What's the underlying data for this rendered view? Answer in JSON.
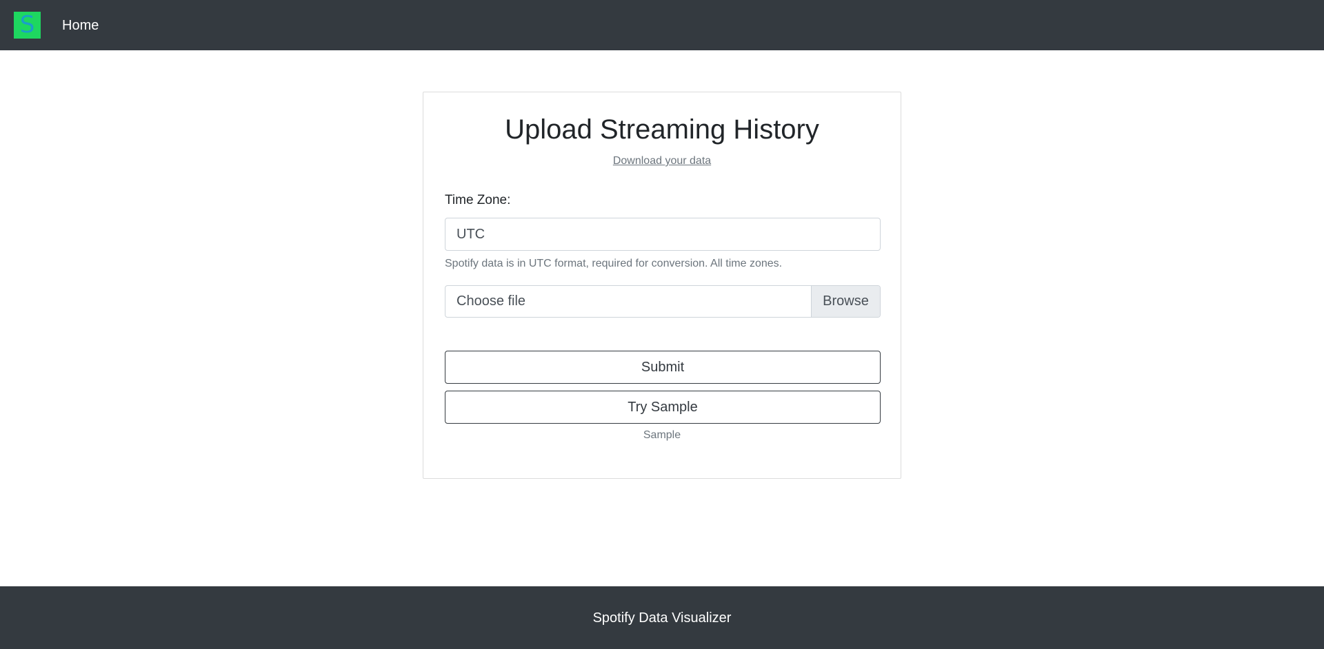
{
  "navbar": {
    "logo_letter": "S",
    "home_label": "Home",
    "background": "#343a40",
    "logo_color": "#1ed760"
  },
  "upload_card": {
    "title": "Upload Streaming History",
    "download_link": "Download your data",
    "timezone": {
      "label": "Time Zone:",
      "value": "UTC",
      "help_text": "Spotify data is in UTC format, required for conversion. All time zones."
    },
    "file": {
      "label": "Choose file",
      "browse_label": "Browse"
    },
    "submit_label": "Submit",
    "try_sample_label": "Try Sample",
    "sample_note": "Sample"
  },
  "footer": {
    "text": "Spotify Data Visualizer"
  }
}
